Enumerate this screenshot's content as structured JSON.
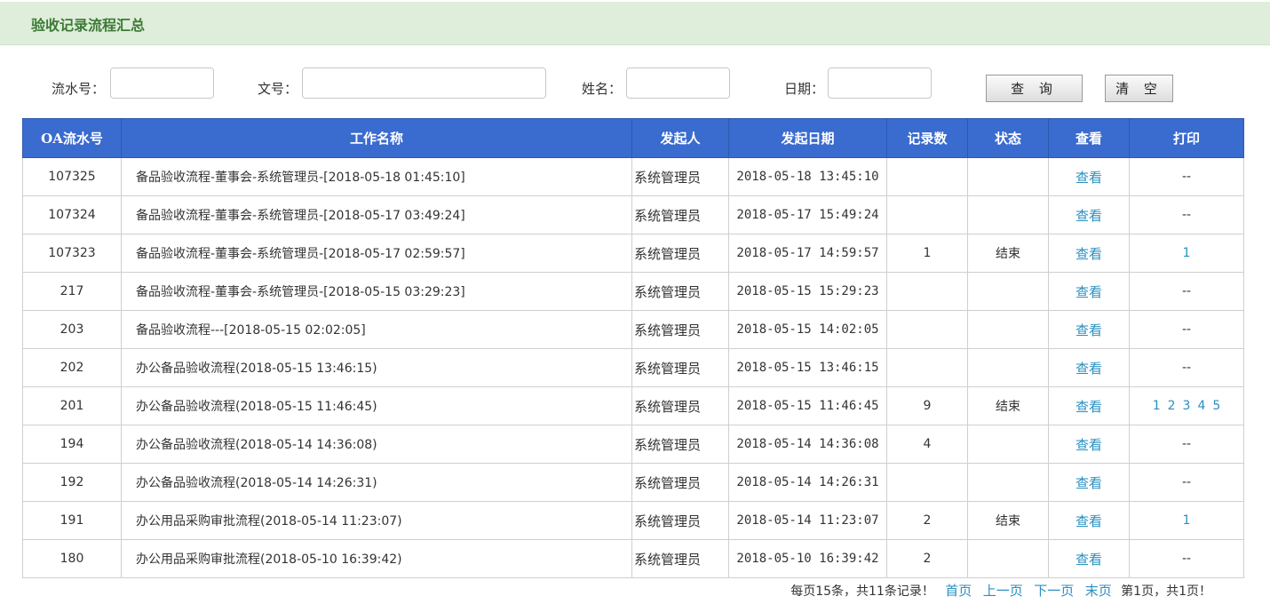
{
  "header": {
    "title": "验收记录流程汇总"
  },
  "search": {
    "serial_label": "流水号：",
    "doc_label": "文号：",
    "name_label": "姓名：",
    "date_label": "日期：",
    "serial_value": "",
    "doc_value": "",
    "name_value": "",
    "date_value": "",
    "query_button": "查 询",
    "clear_button": "清 空"
  },
  "table": {
    "columns": [
      "OA流水号",
      "工作名称",
      "发起人",
      "发起日期",
      "记录数",
      "状态",
      "查看",
      "打印"
    ],
    "rows": [
      {
        "id": "107325",
        "name": "备品验收流程-董事会-系统管理员-[2018-05-18 01:45:10]",
        "starter": "系统管理员",
        "date": "2018-05-18 13:45:10",
        "count": "",
        "status": "",
        "view": "查看",
        "print": "--",
        "print_links": []
      },
      {
        "id": "107324",
        "name": "备品验收流程-董事会-系统管理员-[2018-05-17 03:49:24]",
        "starter": "系统管理员",
        "date": "2018-05-17 15:49:24",
        "count": "",
        "status": "",
        "view": "查看",
        "print": "--",
        "print_links": []
      },
      {
        "id": "107323",
        "name": "备品验收流程-董事会-系统管理员-[2018-05-17 02:59:57]",
        "starter": "系统管理员",
        "date": "2018-05-17 14:59:57",
        "count": "1",
        "status": "结束",
        "view": "查看",
        "print": "",
        "print_links": [
          "1"
        ]
      },
      {
        "id": "217",
        "name": "备品验收流程-董事会-系统管理员-[2018-05-15 03:29:23]",
        "starter": "系统管理员",
        "date": "2018-05-15 15:29:23",
        "count": "",
        "status": "",
        "view": "查看",
        "print": "--",
        "print_links": []
      },
      {
        "id": "203",
        "name": "备品验收流程---[2018-05-15 02:02:05]",
        "starter": "系统管理员",
        "date": "2018-05-15 14:02:05",
        "count": "",
        "status": "",
        "view": "查看",
        "print": "--",
        "print_links": []
      },
      {
        "id": "202",
        "name": "办公备品验收流程(2018-05-15 13:46:15)",
        "starter": "系统管理员",
        "date": "2018-05-15 13:46:15",
        "count": "",
        "status": "",
        "view": "查看",
        "print": "--",
        "print_links": []
      },
      {
        "id": "201",
        "name": "办公备品验收流程(2018-05-15 11:46:45)",
        "starter": "系统管理员",
        "date": "2018-05-15 11:46:45",
        "count": "9",
        "status": "结束",
        "view": "查看",
        "print": "",
        "print_links": [
          "1",
          "2",
          "3",
          "4",
          "5"
        ]
      },
      {
        "id": "194",
        "name": "办公备品验收流程(2018-05-14 14:36:08)",
        "starter": "系统管理员",
        "date": "2018-05-14 14:36:08",
        "count": "4",
        "status": "",
        "view": "查看",
        "print": "--",
        "print_links": []
      },
      {
        "id": "192",
        "name": "办公备品验收流程(2018-05-14 14:26:31)",
        "starter": "系统管理员",
        "date": "2018-05-14 14:26:31",
        "count": "",
        "status": "",
        "view": "查看",
        "print": "--",
        "print_links": []
      },
      {
        "id": "191",
        "name": "办公用品采购审批流程(2018-05-14 11:23:07)",
        "starter": "系统管理员",
        "date": "2018-05-14 11:23:07",
        "count": "2",
        "status": "结束",
        "view": "查看",
        "print": "",
        "print_links": [
          "1"
        ]
      },
      {
        "id": "180",
        "name": "办公用品采购审批流程(2018-05-10 16:39:42)",
        "starter": "系统管理员",
        "date": "2018-05-10 16:39:42",
        "count": "2",
        "status": "",
        "view": "查看",
        "print": "--",
        "print_links": []
      }
    ]
  },
  "pager": {
    "summary": "每页15条，共11条记录！",
    "first": "首页",
    "prev": "上一页",
    "next": "下一页",
    "last": "末页",
    "status": "第1页，共1页！"
  }
}
